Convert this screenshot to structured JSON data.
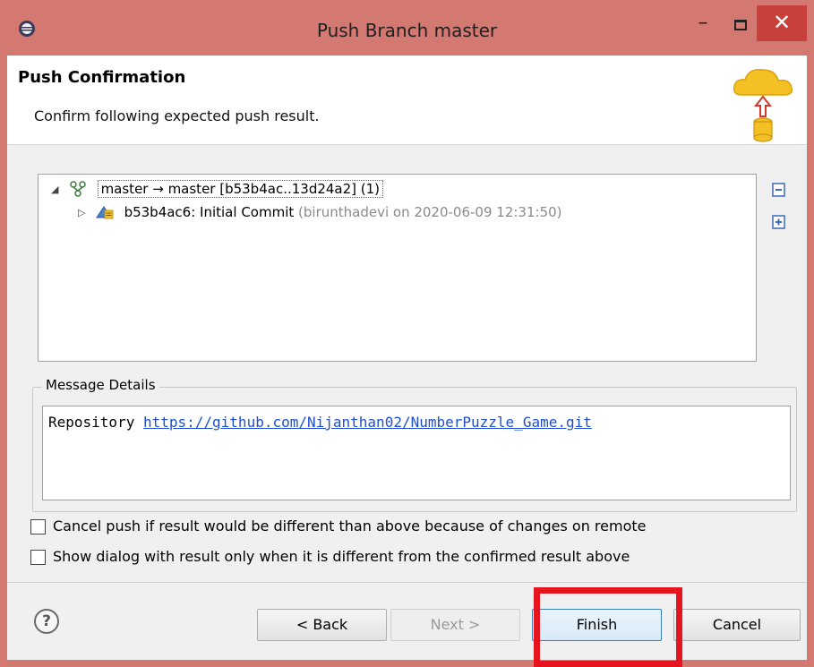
{
  "window": {
    "title": "Push Branch master",
    "minimize_glyph": "–",
    "close_glyph": "✕"
  },
  "header": {
    "title": "Push Confirmation",
    "description": "Confirm following expected push result.",
    "graphic": "cloud-push-database-icon"
  },
  "tree": {
    "rows": [
      {
        "expand_state": "expanded",
        "icon": "branch-icon",
        "label": "master → master [b53b4ac..13d24a2] (1)"
      },
      {
        "expand_state": "collapsed",
        "icon": "commit-icon",
        "label": "b53b4ac6: Initial Commit",
        "meta": "(birunthadevi on 2020-06-09 12:31:50)"
      }
    ],
    "actions": [
      "collapse-all-icon",
      "expand-all-icon"
    ]
  },
  "message_details": {
    "legend": "Message Details",
    "prefix": "Repository",
    "link": "https://github.com/Nijanthan02/NumberPuzzle_Game.git"
  },
  "options": [
    {
      "label": "Cancel push if result would be different than above because of changes on remote",
      "checked": false
    },
    {
      "label": "Show dialog with result only when it is different from the confirmed result above",
      "checked": false
    }
  ],
  "buttons": {
    "help": "?",
    "back": "< Back",
    "next": "Next >",
    "finish": "Finish",
    "cancel": "Cancel"
  },
  "colors": {
    "titlebar": "#d47872",
    "close_button": "#c7403a",
    "highlight": "#e5141e",
    "link": "#1f4fd0"
  }
}
